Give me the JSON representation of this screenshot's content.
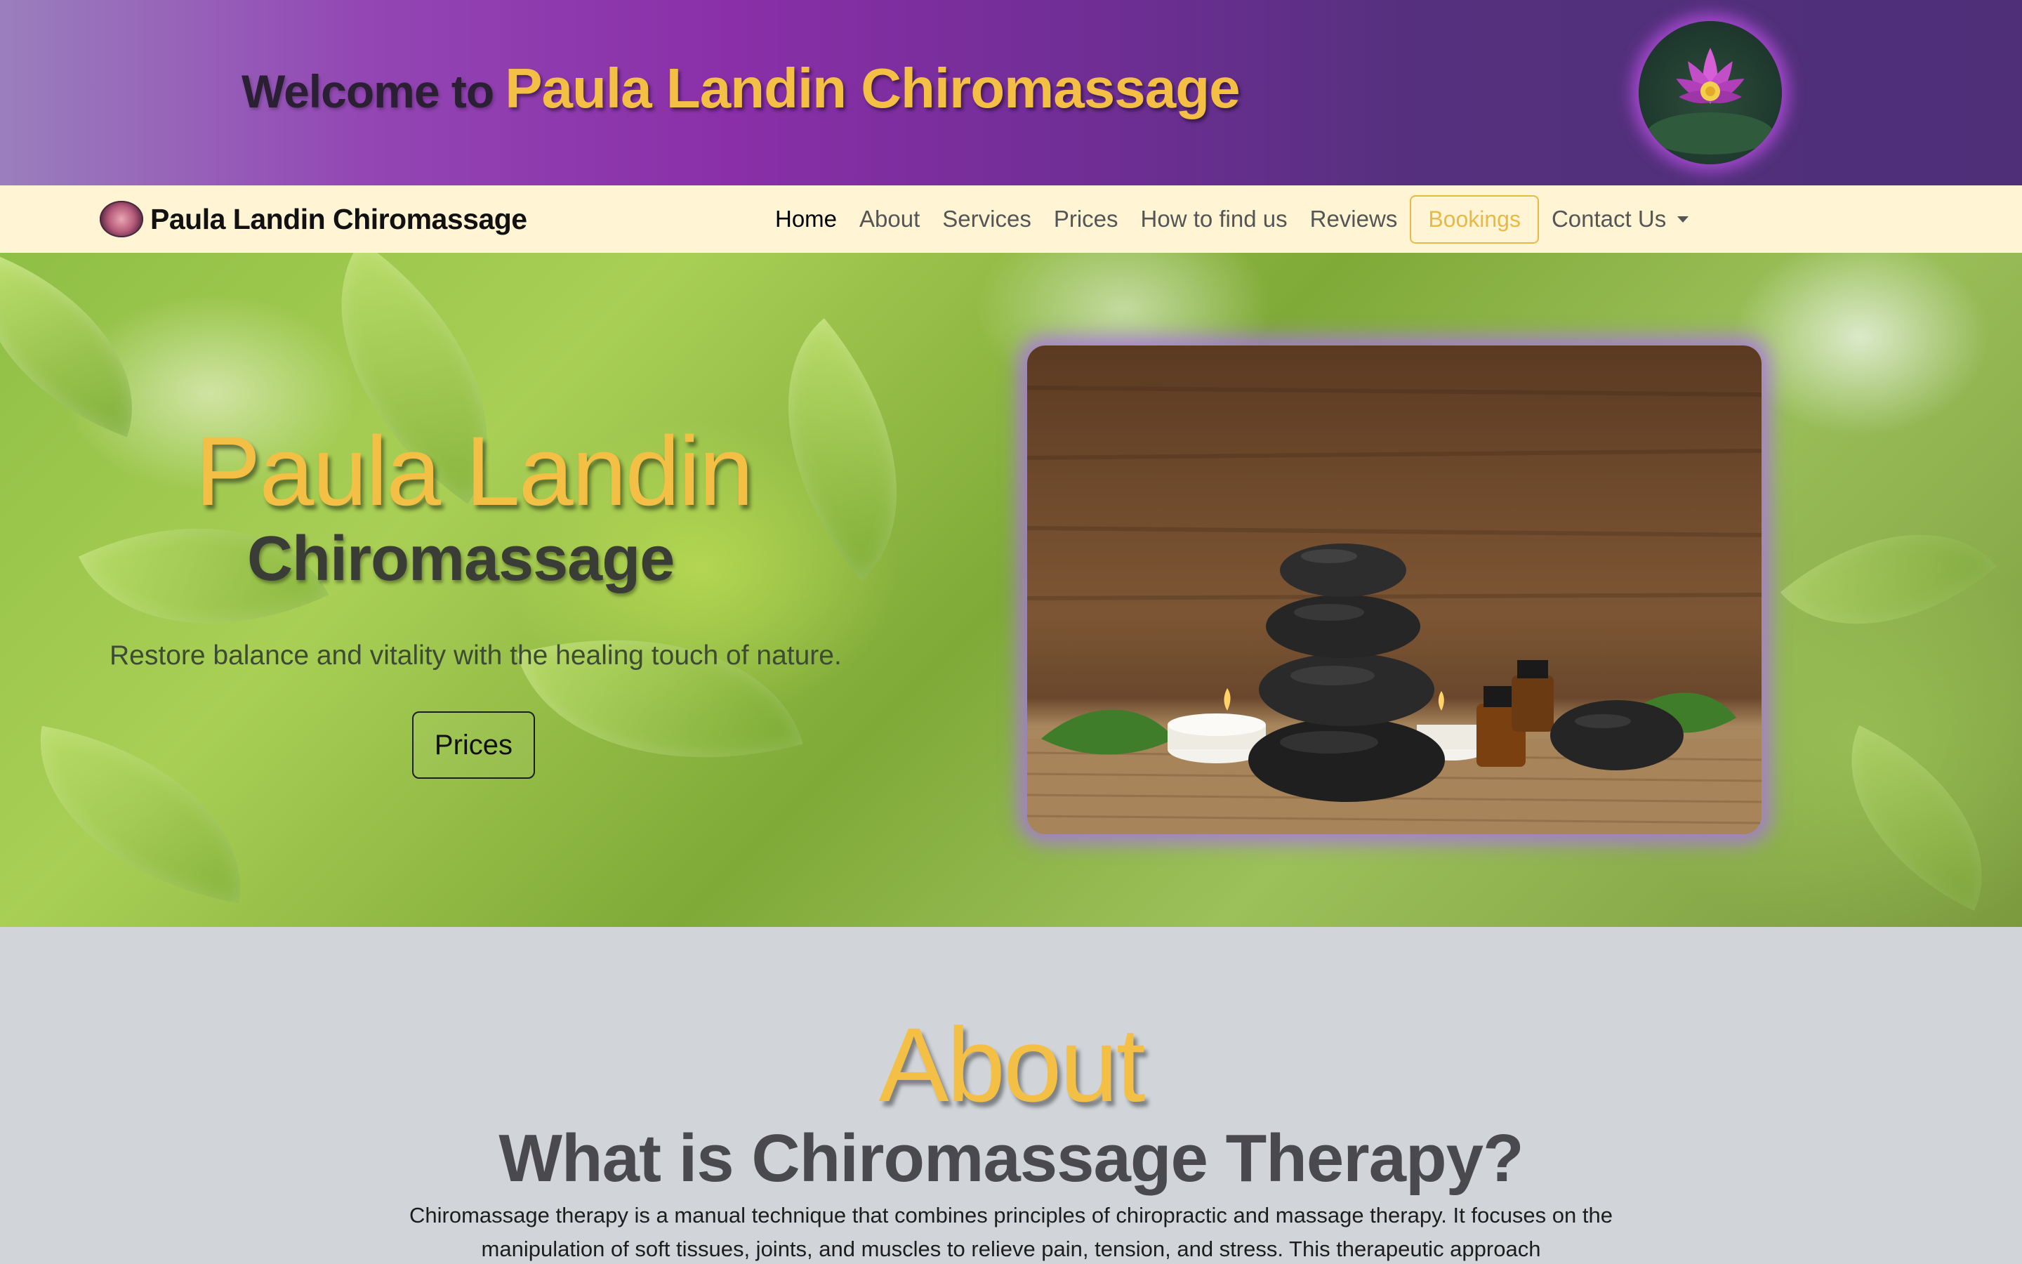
{
  "banner": {
    "welcome_prefix": "Welcome to",
    "brand_name": "Paula Landin Chiromassage",
    "logo_icon": "lotus-flower-icon"
  },
  "navbar": {
    "brand_text": "Paula Landin Chiromassage",
    "brand_icon": "rose-logo-icon",
    "links": [
      {
        "label": "Home",
        "active": true
      },
      {
        "label": "About"
      },
      {
        "label": "Services"
      },
      {
        "label": "Prices"
      },
      {
        "label": "How to find us"
      },
      {
        "label": "Reviews"
      }
    ],
    "bookings_label": "Bookings",
    "contact_label": "Contact Us"
  },
  "hero": {
    "title": "Paula Landin",
    "subtitle": "Chiromassage",
    "tagline": "Restore balance and vitality with the healing touch of nature.",
    "button_label": "Prices",
    "image_icon": "hot-stones-spa-image"
  },
  "about": {
    "heading": "About",
    "subheading": "What is Chiromassage Therapy?",
    "text": "Chiromassage therapy is a manual technique that combines principles of chiropractic and massage therapy. It focuses on the manipulation of soft tissues, joints, and muscles to relieve pain, tension, and stress. This therapeutic approach"
  },
  "colors": {
    "accent_gold": "#f4bf45",
    "nav_background": "#fff4d4",
    "section_background": "#d1d5d9",
    "banner_purple": "#8a2fa8"
  }
}
